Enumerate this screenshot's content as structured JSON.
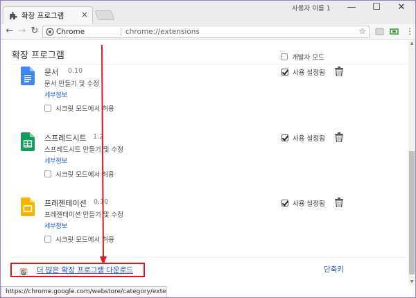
{
  "window": {
    "tab_title": "확장 프로그램",
    "tab_close": "×",
    "profile_name": "사용자 이름 1",
    "minimize": "—",
    "maximize": "☐",
    "close": "✕"
  },
  "toolbar": {
    "back": "←",
    "forward": "→",
    "reload": "↻",
    "secure_label": "Chrome",
    "url": "chrome://extensions",
    "star": "☆",
    "menu": "⋮"
  },
  "page": {
    "title": "확장 프로그램",
    "developer_mode_label": "개발자 모드",
    "developer_mode_checked": false
  },
  "extensions": [
    {
      "name": "문서",
      "version": "0.10",
      "description": "문서 만들기 및 수정",
      "details": "세부정보",
      "incognito": "시크릿 모드에서 허용",
      "enabled_label": "사용 설정됨",
      "enabled": true,
      "icon": "google-docs-icon",
      "color": "#4285f4"
    },
    {
      "name": "스프레드시트",
      "version": "1.2",
      "description": "스프레드시트 만들기 및 수정",
      "details": "세부정보",
      "incognito": "시크릿 모드에서 허용",
      "enabled_label": "사용 설정됨",
      "enabled": true,
      "icon": "google-sheets-icon",
      "color": "#0f9d58"
    },
    {
      "name": "프레젠테이션",
      "version": "0.10",
      "description": "프레젠테이션 만들기 및 수정",
      "details": "세부정보",
      "incognito": "시크릿 모드에서 허용",
      "enabled_label": "사용 설정됨",
      "enabled": true,
      "icon": "google-slides-icon",
      "color": "#f4b400"
    }
  ],
  "footer": {
    "more_extensions": "더 많은 확장 프로그램 다운로드",
    "shortcuts": "단축키"
  },
  "status_bar": "https://chrome.google.com/webstore/category/extensions?hl=ko",
  "colors": {
    "annotation": "#e0161f",
    "link": "#1a55c8"
  }
}
